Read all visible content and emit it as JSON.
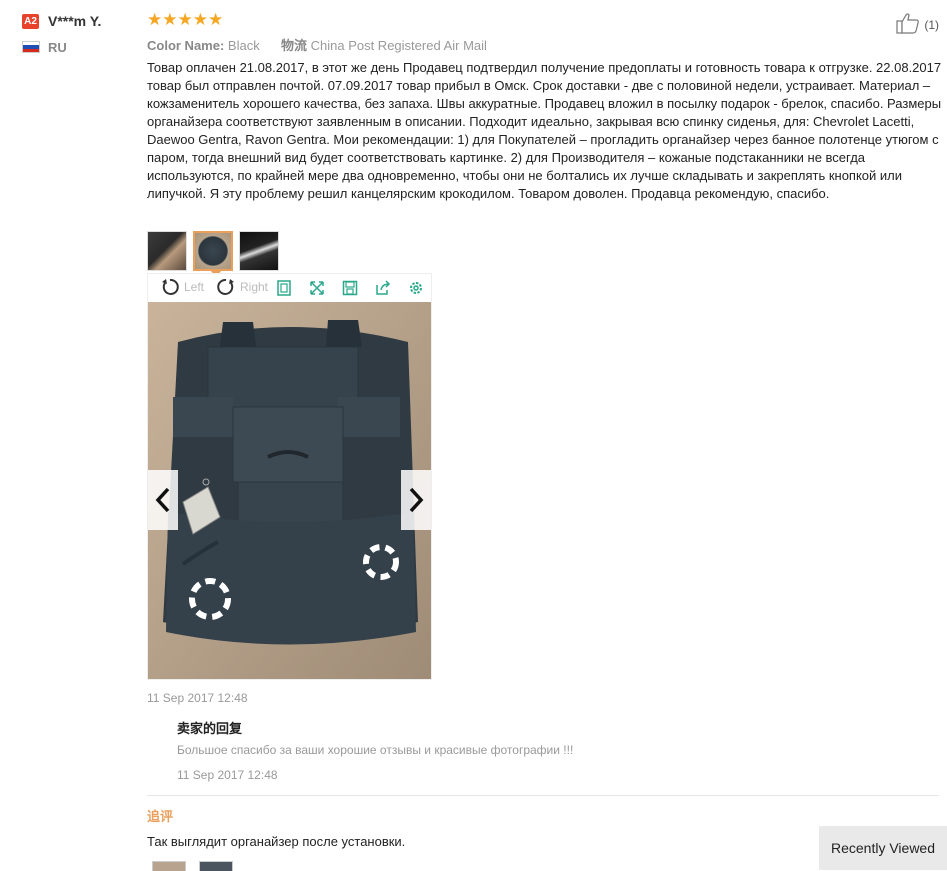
{
  "reviewer": {
    "badge": "A2",
    "name": "V***m Y.",
    "country": "RU",
    "flag_colors": [
      "#ffffff",
      "#1f4fb4",
      "#d52b1e"
    ]
  },
  "rating": {
    "stars": "★★★★★",
    "value": 5,
    "max": 5
  },
  "attributes": {
    "color_label": "Color Name:",
    "color_value": "Black",
    "shipping_label": "物流",
    "shipping_value": "China Post Registered Air Mail"
  },
  "helpful": {
    "icon": "thumbs-up-icon",
    "count": "(1)"
  },
  "review_text": "Товар оплачен 21.08.2017, в этот же день Продавец подтвердил получение предоплаты и готовность товара к отгрузке. 22.08.2017 товар был отправлен почтой. 07.09.2017 товар прибыл в Омск. Срок доставки - две с половиной недели, устраивает. Материал – кожзаменитель хорошего качества, без запаха. Швы аккуратные. Продавец вложил в посылку подарок - брелок, спасибо. Размеры органайзера соответствуют заявленным в описании. Подходит идеально, закрывая всю спинку сиденья, для: Chevrolet Lacetti, Daewoo Gentra, Ravon Gentra. Мои рекомендации: 1) для Покупателей – прогладить органайзер через банное полотенце утюгом с паром, тогда внешний вид будет соответствовать картинке. 2) для Производителя – кожаные подстаканники не всегда используются, по крайней мере два одновременно, чтобы они не болтались их лучше складывать и закреплять кнопкой или липучкой. Я эту проблему решил канцелярским крокодилом. Товаром доволен. Продавца рекомендую, спасибо.",
  "viewer": {
    "rotate_left": "Left",
    "rotate_right": "Right",
    "tools": [
      "fit-icon",
      "fullscreen-icon",
      "save-icon",
      "share-icon",
      "settings-icon"
    ]
  },
  "review_date": "11 Sep 2017 12:48",
  "seller_reply": {
    "title": "卖家的回复",
    "text": "Большое спасибо за ваши хорошие отзывы и красивые фотографии !!!",
    "date": "11 Sep 2017 12:48"
  },
  "additional": {
    "title": "追评",
    "text": "Так выглядит органайзер после установки."
  },
  "recently_viewed": "Recently Viewed"
}
